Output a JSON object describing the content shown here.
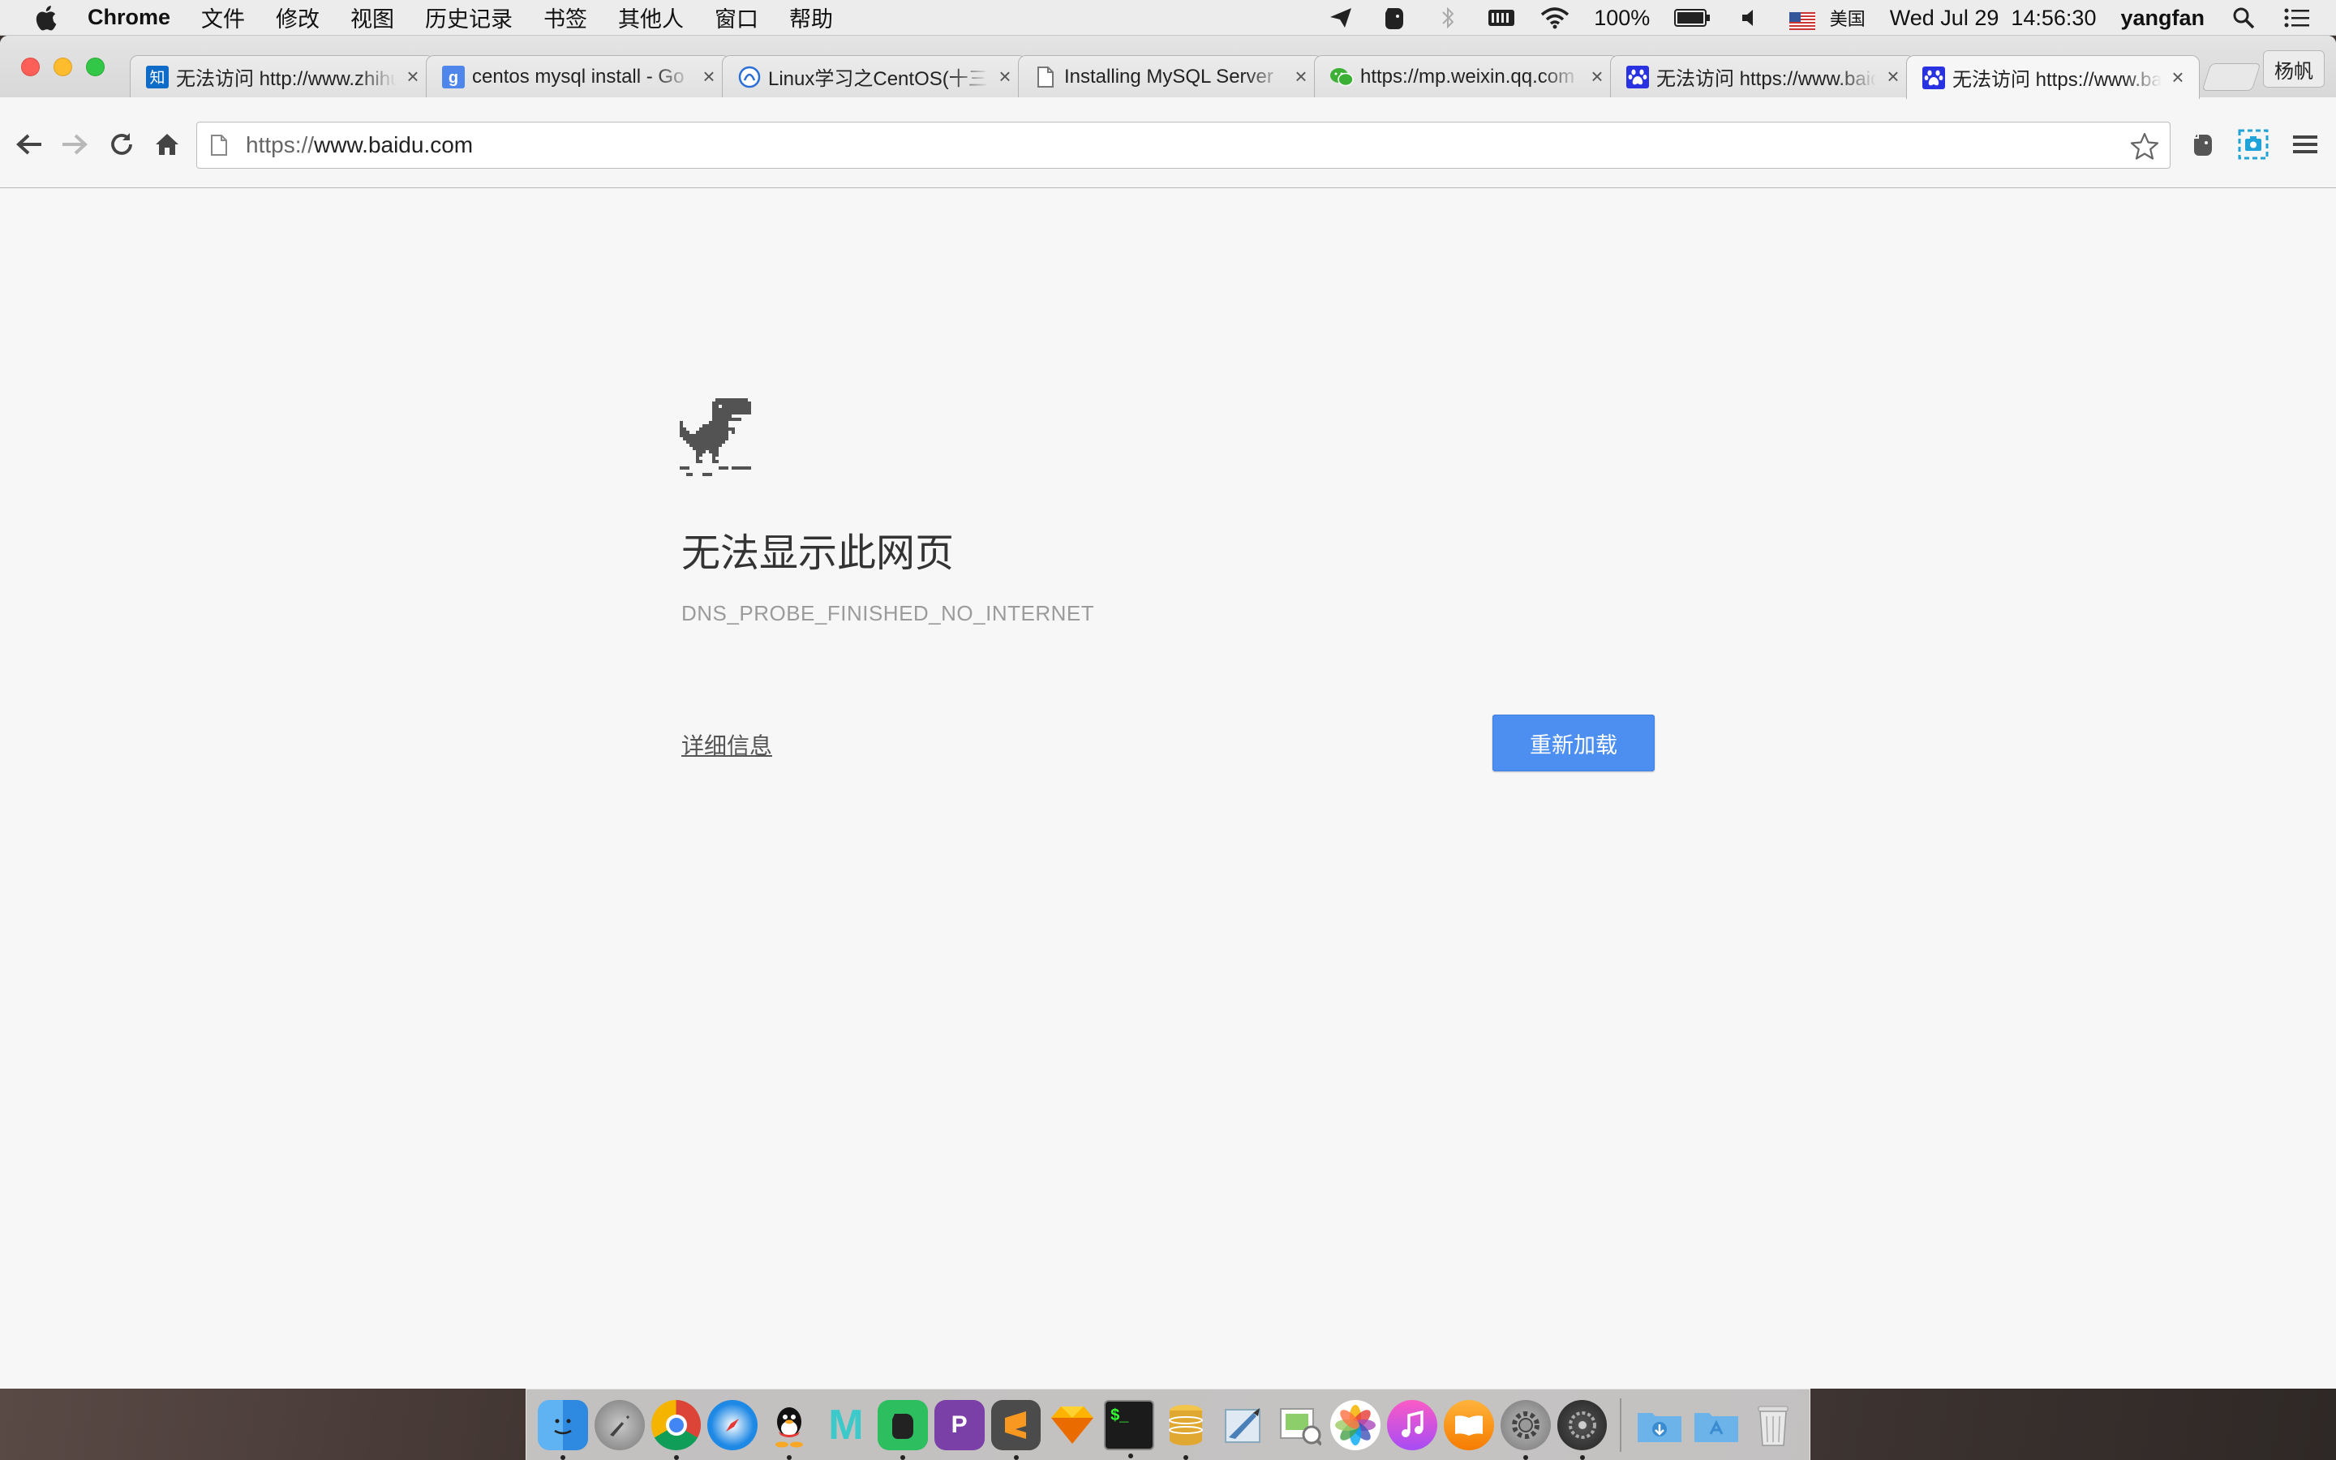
{
  "menubar": {
    "app_name": "Chrome",
    "menus": [
      "文件",
      "修改",
      "视图",
      "历史记录",
      "书签",
      "其他人",
      "窗口",
      "帮助"
    ],
    "battery": "100%",
    "input_source": "美国",
    "clock": "Wed Jul 29  14:56:30",
    "user": "yangfan"
  },
  "tabs": [
    {
      "title": "无法访问 http://www.zhihu",
      "favicon": "zhihu-icon",
      "active": false
    },
    {
      "title": "centos mysql install - Go",
      "favicon": "google-icon",
      "active": false
    },
    {
      "title": "Linux学习之CentOS(十三)",
      "favicon": "blog-icon",
      "active": false
    },
    {
      "title": "Installing MySQL Server",
      "favicon": "page-icon",
      "active": false
    },
    {
      "title": "https://mp.weixin.qq.com",
      "favicon": "wechat-icon",
      "active": false
    },
    {
      "title": "无法访问 https://www.baidu",
      "favicon": "baidu-icon",
      "active": false
    },
    {
      "title": "无法访问 https://www.baidu",
      "favicon": "baidu-icon",
      "active": true
    }
  ],
  "profile_name": "杨帆",
  "omnibox": {
    "scheme": "https://",
    "host": "www.baidu.com"
  },
  "error_page": {
    "title": "无法显示此网页",
    "error_code": "DNS_PROBE_FINISHED_NO_INTERNET",
    "details_link": "详细信息",
    "reload_button": "重新加载"
  },
  "dock": [
    {
      "name": "finder-icon",
      "running": true
    },
    {
      "name": "launchpad-icon",
      "running": false
    },
    {
      "name": "chrome-icon",
      "running": true
    },
    {
      "name": "safari-icon",
      "running": false
    },
    {
      "name": "qq-icon",
      "running": true
    },
    {
      "name": "mou-icon",
      "running": false
    },
    {
      "name": "evernote-icon",
      "running": true
    },
    {
      "name": "pocket-icon",
      "running": false
    },
    {
      "name": "sublime-icon",
      "running": true
    },
    {
      "name": "sketch-icon",
      "running": false
    },
    {
      "name": "terminal-icon",
      "running": true
    },
    {
      "name": "sequel-pro-icon",
      "running": true
    },
    {
      "name": "mail-icon",
      "running": false
    },
    {
      "name": "preview-icon",
      "running": false
    },
    {
      "name": "photos-icon",
      "running": false
    },
    {
      "name": "itunes-icon",
      "running": false
    },
    {
      "name": "ibooks-icon",
      "running": false
    },
    {
      "name": "settings-icon",
      "running": true
    },
    {
      "name": "disk-utility-icon",
      "running": true
    },
    {
      "name": "downloads-folder-icon",
      "running": false
    },
    {
      "name": "applications-folder-icon",
      "running": false
    },
    {
      "name": "trash-icon",
      "running": false
    }
  ],
  "colors": {
    "reload_button": "#4c8ff0",
    "page_bg": "#f7f7f7",
    "error_code_text": "#9b9b9b"
  }
}
